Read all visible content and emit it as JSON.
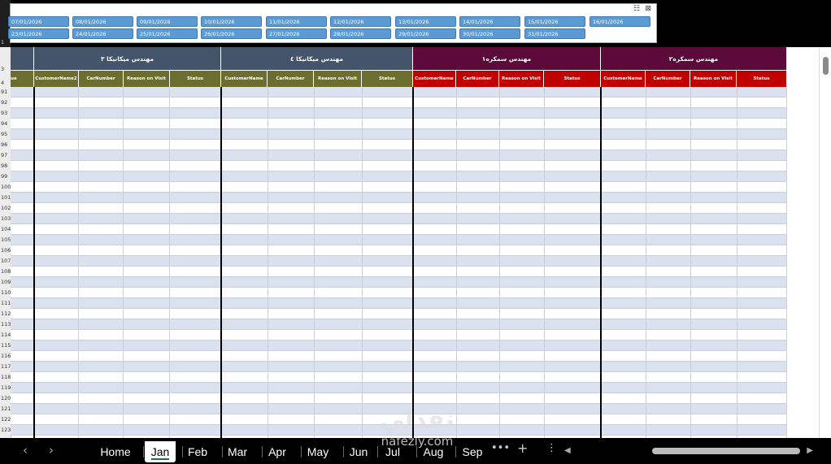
{
  "slicer": {
    "dates_row1": [
      "07/01/2026",
      "08/01/2026",
      "09/01/2026",
      "10/01/2026",
      "11/01/2026",
      "12/01/2026",
      "13/01/2026",
      "14/01/2026",
      "15/01/2026",
      "16/01/2026"
    ],
    "dates_row2": [
      "23/01/2026",
      "24/01/2026",
      "25/01/2026",
      "26/01/2026",
      "27/01/2026",
      "28/01/2026",
      "29/01/2026",
      "30/01/2026",
      "31/01/2026"
    ],
    "multi_select_icon": "multi-select-icon",
    "clear_filter_icon": "clear-filter-icon"
  },
  "top_row_labels": [
    "1",
    "3",
    "4"
  ],
  "left_partial_header": "ue",
  "groups": [
    {
      "title": "مهندس ميكانيكا ٣",
      "color": "#44546a"
    },
    {
      "title": "مهندس ميكانيكا ٤",
      "color": "#44546a"
    },
    {
      "title": "مهندس سمكره١",
      "color": "#5c0a3a"
    },
    {
      "title": "مهندس سمكره٢",
      "color": "#5c0a3a"
    }
  ],
  "columns": [
    [
      "CustomerName2",
      "CarNumber",
      "Reason on Visit",
      "Status"
    ],
    [
      "CustomerName",
      "CarNumber",
      "Reason on Visit",
      "Status"
    ],
    [
      "CustomerName",
      "CarNumber",
      "Reason on Visit",
      "Status"
    ],
    [
      "CustomerName",
      "CarNumber",
      "Reason on Visit",
      "Status"
    ]
  ],
  "column_colors": {
    "olive": "#6b6e2e",
    "red": "#c00000"
  },
  "row_numbers": [
    "91",
    "92",
    "93",
    "94",
    "95",
    "96",
    "97",
    "98",
    "99",
    "100",
    "101",
    "102",
    "103",
    "104",
    "105",
    "106",
    "107",
    "108",
    "109",
    "110",
    "111",
    "112",
    "113",
    "114",
    "115",
    "116",
    "117",
    "118",
    "119",
    "120",
    "121",
    "122",
    "123"
  ],
  "tabs": {
    "prev_icon": "chevron-left-icon",
    "next_icon": "chevron-right-icon",
    "items": [
      "Home",
      "Jan",
      "Feb",
      "Mar",
      "Apr",
      "May",
      "Jun",
      "Jul",
      "Aug",
      "Sep"
    ],
    "active": "Jan",
    "more": "•••",
    "add": "+",
    "menu": "⋮"
  },
  "watermark": {
    "arabic": "نفذلي",
    "latin": "nafezly.com"
  }
}
